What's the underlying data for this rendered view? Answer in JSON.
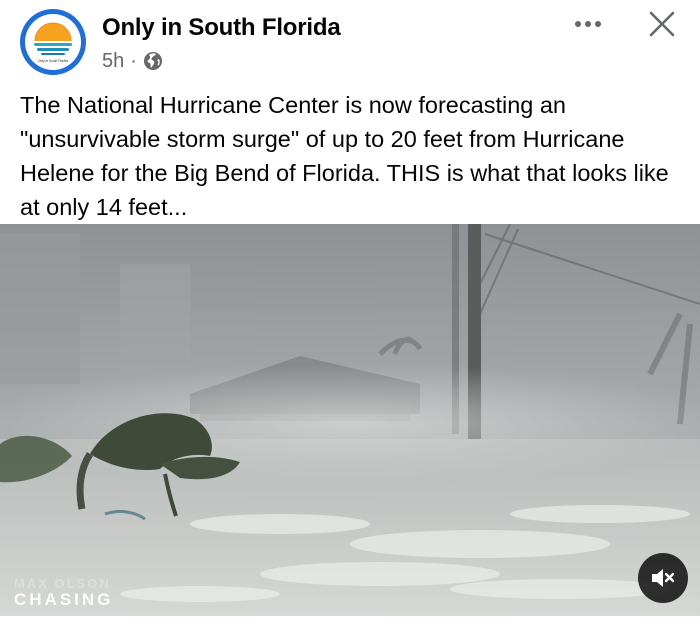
{
  "post": {
    "author": "Only in South Florida",
    "time": "5h",
    "separator": "·",
    "audience_icon": "globe-icon",
    "text": "The National Hurricane Center is now forecasting an \"unsurvivable storm surge\" of up to 20 feet from Hurricane Helene for the Big Bend of Florida. THIS is what that looks like at only 14 feet...",
    "more_icon": "more-options-icon",
    "close_icon": "close-icon"
  },
  "avatar": {
    "logo_text": "Only in South Florida",
    "ring_color": "#1e6fd9"
  },
  "media": {
    "watermark_top": "MAX OLSON",
    "watermark_bottom": "CHASING",
    "mute_icon": "muted-speaker-icon"
  },
  "colors": {
    "text_primary": "#050505",
    "text_secondary": "#65676b",
    "background": "#ffffff"
  }
}
